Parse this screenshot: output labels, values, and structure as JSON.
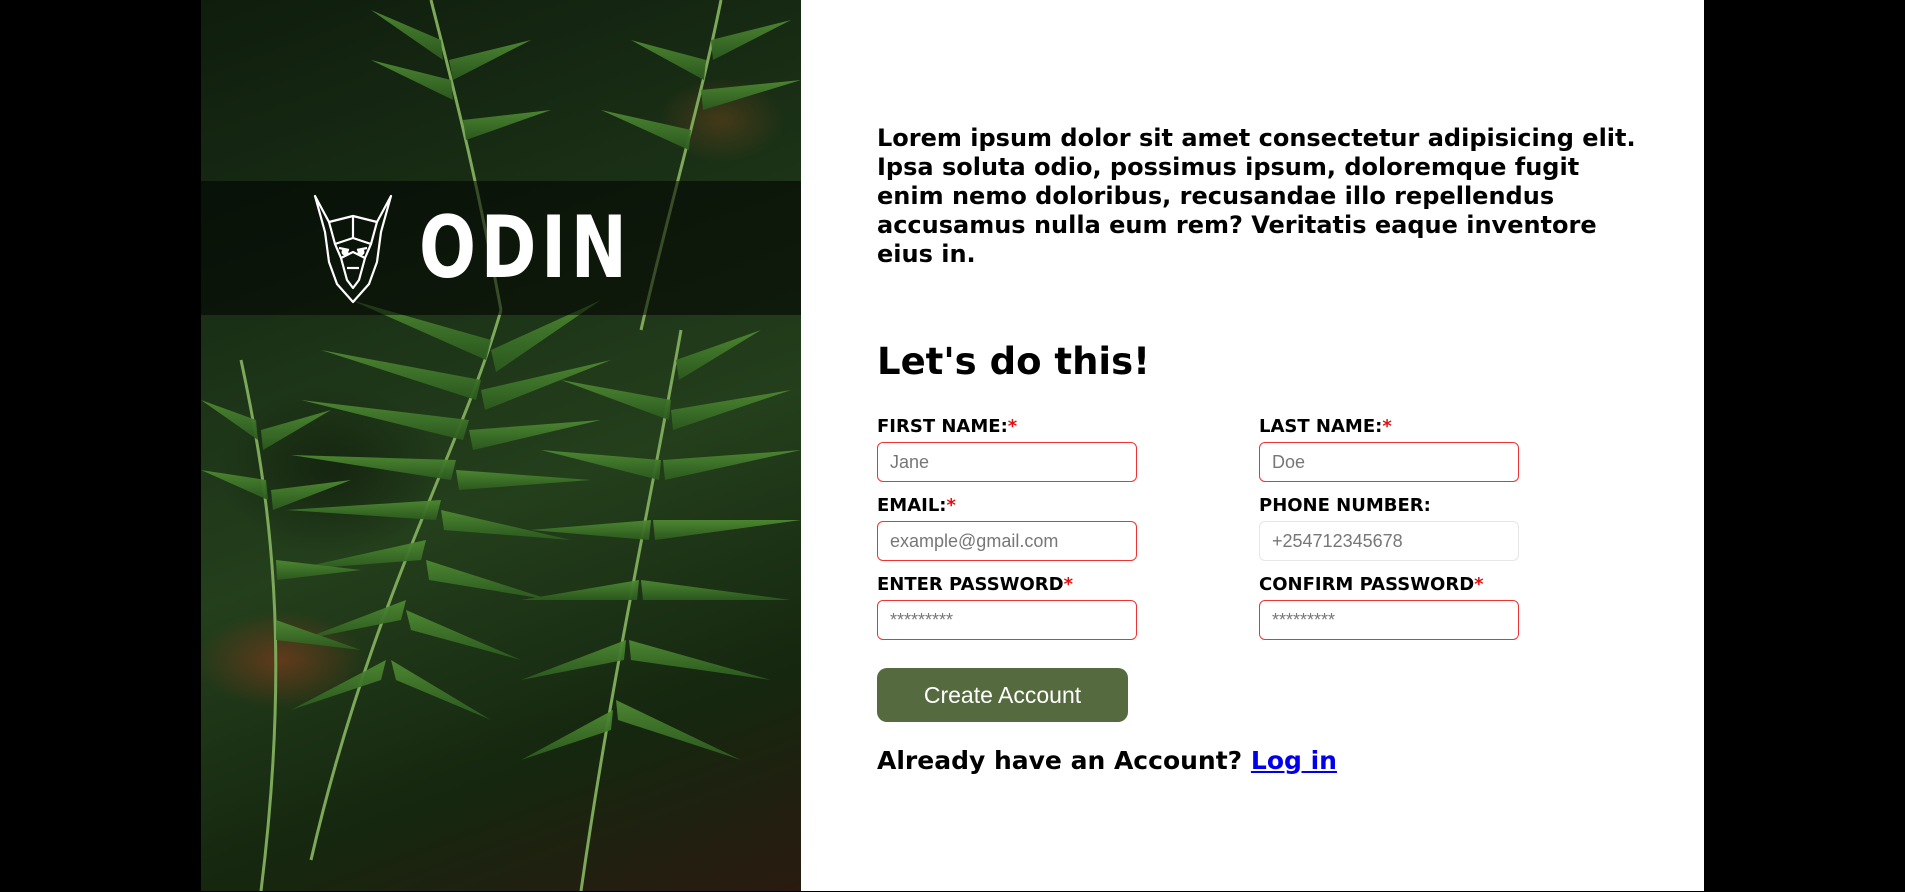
{
  "brand": {
    "name": "ODIN",
    "logo_icon": "viking-helmet-icon"
  },
  "intro_text": "Lorem ipsum dolor sit amet consectetur adipisicing elit. Ipsa soluta odio, possimus ipsum, doloremque fugit enim nemo doloribus, recusandae illo repellendus accusamus nulla eum rem? Veritatis eaque inventore eius in.",
  "form": {
    "heading": "Let's do this!",
    "required_mark": "*",
    "first_name": {
      "label": "FIRST NAME:",
      "placeholder": "Jane"
    },
    "last_name": {
      "label": "LAST NAME:",
      "placeholder": "Doe"
    },
    "email": {
      "label": "EMAIL:",
      "placeholder": "example@gmail.com"
    },
    "phone": {
      "label": "PHONE NUMBER:",
      "placeholder": "+254712345678"
    },
    "password": {
      "label": "ENTER PASSWORD",
      "placeholder": "*********"
    },
    "confirm_password": {
      "label": "CONFIRM PASSWORD",
      "placeholder": "*********"
    },
    "submit_label": "Create Account"
  },
  "login": {
    "prompt": "Already have an Account?",
    "link_label": "Log in"
  },
  "colors": {
    "accent_button": "#556b3f",
    "required_border": "#ee3333",
    "link": "#0000ee"
  }
}
